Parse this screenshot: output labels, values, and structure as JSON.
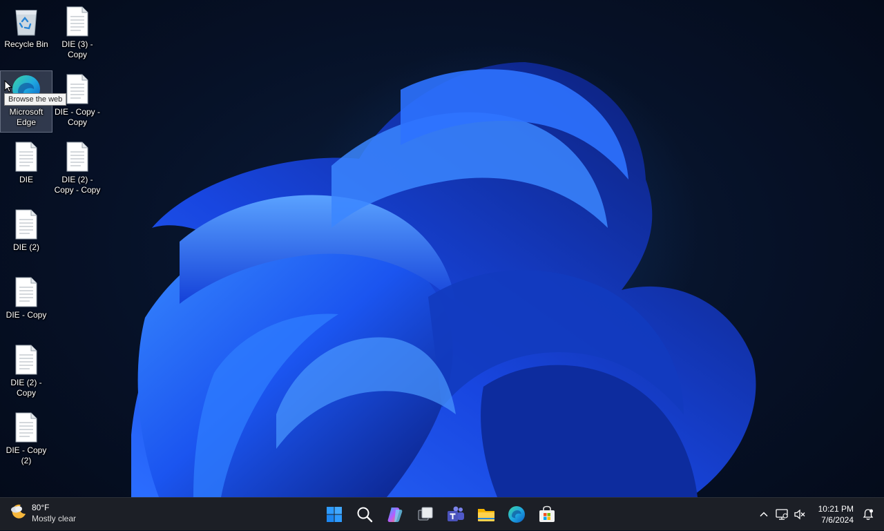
{
  "desktop": {
    "icons": [
      {
        "label": "Recycle Bin",
        "icon": "recycle-bin-icon"
      },
      {
        "label": "DIE (3) - Copy",
        "icon": "text-file-icon"
      },
      {
        "label": "Microsoft Edge",
        "icon": "edge-icon"
      },
      {
        "label": "DIE - Copy - Copy",
        "icon": "text-file-icon"
      },
      {
        "label": "DIE",
        "icon": "text-file-icon"
      },
      {
        "label": "DIE (2) - Copy - Copy",
        "icon": "text-file-icon"
      },
      {
        "label": "DIE (2)",
        "icon": "text-file-icon"
      },
      {
        "label": "DIE - Copy",
        "icon": "text-file-icon"
      },
      {
        "label": "DIE (2) - Copy",
        "icon": "text-file-icon"
      },
      {
        "label": "DIE - Copy (2)",
        "icon": "text-file-icon"
      }
    ],
    "tooltip": "Browse the web",
    "selected_icon": "Microsoft Edge"
  },
  "taskbar": {
    "weather": {
      "temperature": "80°F",
      "condition": "Mostly clear",
      "icon": "moon-cloud-icon"
    },
    "apps": [
      {
        "name": "Start",
        "icon": "windows-start-icon"
      },
      {
        "name": "Search",
        "icon": "search-icon"
      },
      {
        "name": "Copilot",
        "icon": "copilot-icon"
      },
      {
        "name": "Task View",
        "icon": "task-view-icon"
      },
      {
        "name": "Microsoft Teams",
        "icon": "teams-icon"
      },
      {
        "name": "File Explorer",
        "icon": "file-explorer-icon"
      },
      {
        "name": "Microsoft Edge",
        "icon": "edge-icon"
      },
      {
        "name": "Microsoft Store",
        "icon": "store-icon"
      }
    ],
    "tray": {
      "icons": [
        "chevron-up-icon",
        "network-icon",
        "volume-muted-icon"
      ],
      "time": "10:21 PM",
      "date": "7/6/2024",
      "notification_icon": "notification-bell-icon"
    }
  },
  "colors": {
    "accent": "#1a6cff",
    "taskbar": "#1c1f26",
    "background": "#06101f"
  }
}
